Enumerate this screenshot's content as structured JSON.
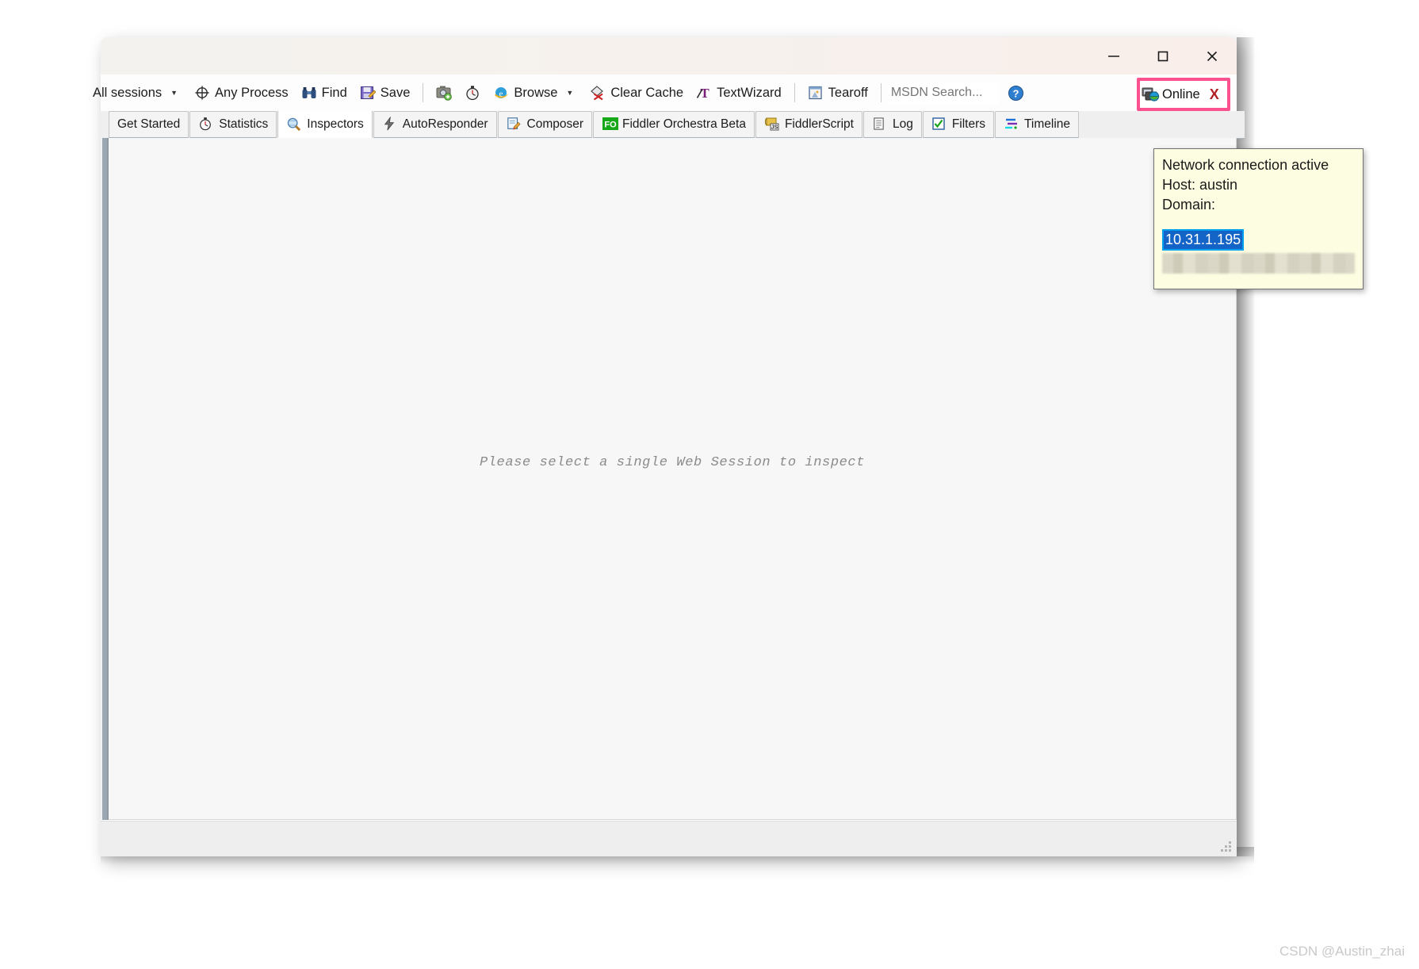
{
  "window": {
    "title": "",
    "controls": {
      "minimize_label": "Minimize",
      "maximize_label": "Maximize",
      "close_label": "Close"
    }
  },
  "toolbar": {
    "sessions_filter": "All sessions",
    "process_filter": "Any Process",
    "find": "Find",
    "save": "Save",
    "browse": "Browse",
    "clear_cache": "Clear Cache",
    "text_wizard": "TextWizard",
    "tearoff": "Tearoff",
    "msdn_search_placeholder": "MSDN Search...",
    "msdn_search_value": "",
    "online_label": "Online",
    "online_close": "X",
    "highlight_color": "#f9528f"
  },
  "tabs": [
    {
      "label": "Get Started",
      "icon": "",
      "active": false
    },
    {
      "label": "Statistics",
      "icon": "stopwatch-icon",
      "active": false
    },
    {
      "label": "Inspectors",
      "icon": "magnifier-icon",
      "active": true
    },
    {
      "label": "AutoResponder",
      "icon": "lightning-icon",
      "active": false
    },
    {
      "label": "Composer",
      "icon": "compose-icon",
      "active": false
    },
    {
      "label": "Fiddler Orchestra Beta",
      "icon": "fo-icon",
      "active": false
    },
    {
      "label": "FiddlerScript",
      "icon": "js-icon",
      "active": false
    },
    {
      "label": "Log",
      "icon": "log-icon",
      "active": false
    },
    {
      "label": "Filters",
      "icon": "checkbox-icon",
      "active": false
    },
    {
      "label": "Timeline",
      "icon": "timeline-icon",
      "active": false
    }
  ],
  "content": {
    "empty_message": "Please select a single Web Session to inspect"
  },
  "tooltip": {
    "line1": "Network connection active",
    "line2": "Host: austin",
    "line3": "Domain:",
    "selected_ip": "10.31.1.195",
    "redacted_line": ""
  },
  "watermark": {
    "text": "CSDN @Austin_zhai"
  }
}
